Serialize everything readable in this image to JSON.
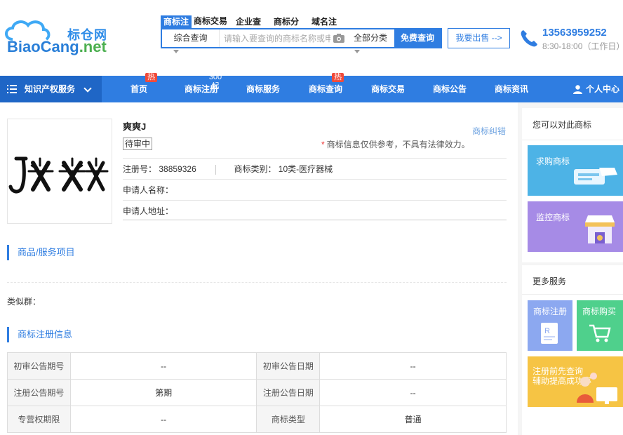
{
  "header": {
    "logo_cn": "标仓网",
    "logo_en_a": "BiaoCang",
    "logo_en_b": ".net",
    "search_tabs": [
      "商标注",
      "商标交易",
      "企业查",
      "商标分",
      "域名注"
    ],
    "search_type": "综合查询",
    "search_placeholder": "请输入要查询的商标名称或申",
    "search_category": "全部分类",
    "search_button": "免费查询",
    "sell_button": "我要出售 -->",
    "phone": "13563959252",
    "hours": "8:30-18:00（工作日）"
  },
  "nav": {
    "category_label": "知识产权服务",
    "items": [
      {
        "label": "首页",
        "badge": "热"
      },
      {
        "label": "商标注册",
        "badge": "300起"
      },
      {
        "label": "商标服务",
        "badge": ""
      },
      {
        "label": "商标查询",
        "badge": "热"
      },
      {
        "label": "商标交易",
        "badge": ""
      },
      {
        "label": "商标公告",
        "badge": ""
      },
      {
        "label": "商标资讯",
        "badge": ""
      }
    ],
    "user_center": "个人中心"
  },
  "trademark": {
    "name": "爽爽J",
    "dispute_link": "商标纠错",
    "status": "待审中",
    "notice": "商标信息仅供参考，不具有法律效力。",
    "reg_no_label": "注册号：",
    "reg_no": "38859326",
    "class_label": "商标类别：",
    "class_value": "10类-医疗器械",
    "applicant_name_label": "申请人名称：",
    "applicant_addr_label": "申请人地址："
  },
  "sections": {
    "goods": "商品/服务项目",
    "similar_label": "类似群：",
    "registration": "商标注册信息"
  },
  "table": [
    [
      {
        "label": "初审公告期号",
        "value": "--"
      },
      {
        "label": "初审公告日期",
        "value": "--"
      }
    ],
    [
      {
        "label": "注册公告期号",
        "value": "第期"
      },
      {
        "label": "注册公告日期",
        "value": "--"
      }
    ],
    [
      {
        "label": "专营权期限",
        "value": "--"
      },
      {
        "label": "商标类型",
        "value": "普通"
      }
    ]
  ],
  "sidebar": {
    "compare_title": "您可以对此商标",
    "buy_card": "求购商标",
    "monitor_card": "监控商标",
    "more_title": "更多服务",
    "reg_card": "商标注册",
    "purchase_card": "商标购买",
    "consult_line1": "注册前先查询",
    "consult_line2": "辅助提高成功率"
  },
  "colors": {
    "primary": "#2f7de1",
    "nav_dark": "#1f66c6",
    "badge": "#f04a3a"
  }
}
